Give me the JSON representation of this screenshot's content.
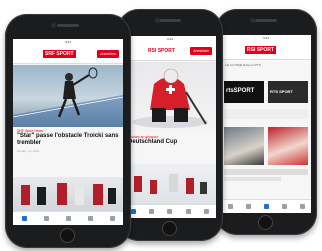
{
  "phones": {
    "left": {
      "logo": "SRF SPORT",
      "login": "Anmelden",
      "kicker": "SRF Sport News",
      "headline": "\"Star\" passe l'obstacle Troicki sans trembler",
      "meta": "Tennis · il y a 2h"
    },
    "middle": {
      "logo": "RSI SPORT",
      "login": "Anmelden",
      "kicker": "Hockey su ghiaccio",
      "headline": "Deutschland Cup",
      "meta": "2h"
    },
    "right": {
      "logo": "RSI SPORT",
      "login": "",
      "section": "LE ULTIME DALLA RTS",
      "tile_a": "rtsSPORT",
      "tile_b": "RTS SPORT"
    }
  },
  "colors": {
    "brand": "#e2001a",
    "accent": "#1e6fd9"
  }
}
